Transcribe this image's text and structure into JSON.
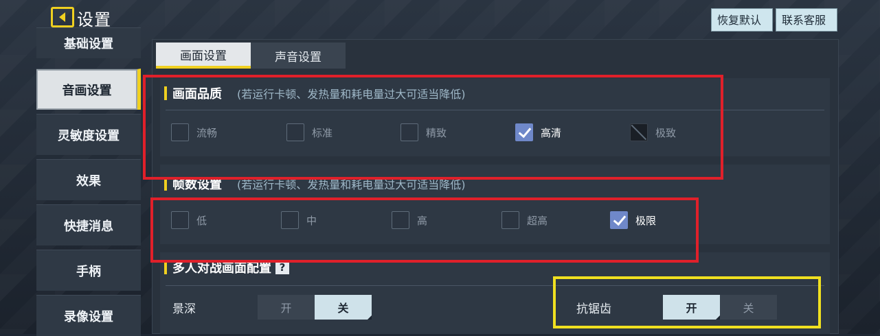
{
  "header": {
    "title": "设置",
    "restore_label": "恢复默认",
    "contact_label": "联系客服"
  },
  "sidebar": {
    "items": [
      {
        "label": "基础设置"
      },
      {
        "label": "音画设置"
      },
      {
        "label": "灵敏度设置"
      },
      {
        "label": "效果"
      },
      {
        "label": "快捷消息"
      },
      {
        "label": "手柄"
      },
      {
        "label": "录像设置"
      }
    ],
    "active_index": 1
  },
  "tabs": [
    {
      "label": "画面设置"
    },
    {
      "label": "声音设置"
    }
  ],
  "quality": {
    "title": "画面品质",
    "note": "(若运行卡顿、发热量和耗电量过大可适当降低)",
    "options": [
      {
        "label": "流畅",
        "checked": false
      },
      {
        "label": "标准",
        "checked": false
      },
      {
        "label": "精致",
        "checked": false
      },
      {
        "label": "高清",
        "checked": true
      },
      {
        "label": "极致",
        "checked": false,
        "disabled": true
      }
    ]
  },
  "framerate": {
    "title": "帧数设置",
    "note": "(若运行卡顿、发热量和耗电量过大可适当降低)",
    "options": [
      {
        "label": "低",
        "checked": false
      },
      {
        "label": "中",
        "checked": false
      },
      {
        "label": "高",
        "checked": false
      },
      {
        "label": "超高",
        "checked": false
      },
      {
        "label": "极限",
        "checked": true
      }
    ]
  },
  "multiplayer": {
    "title": "多人对战画面配置",
    "help": "?",
    "depth": {
      "label": "景深",
      "on": "开",
      "off": "关",
      "value": "off"
    },
    "antialias": {
      "label": "抗锯齿",
      "on": "开",
      "off": "关",
      "value": "on"
    }
  },
  "colors": {
    "accent": "#f0d020",
    "highlight_red": "#e0202a",
    "highlight_yellow": "#f0e020",
    "check": "#6f88c9"
  }
}
